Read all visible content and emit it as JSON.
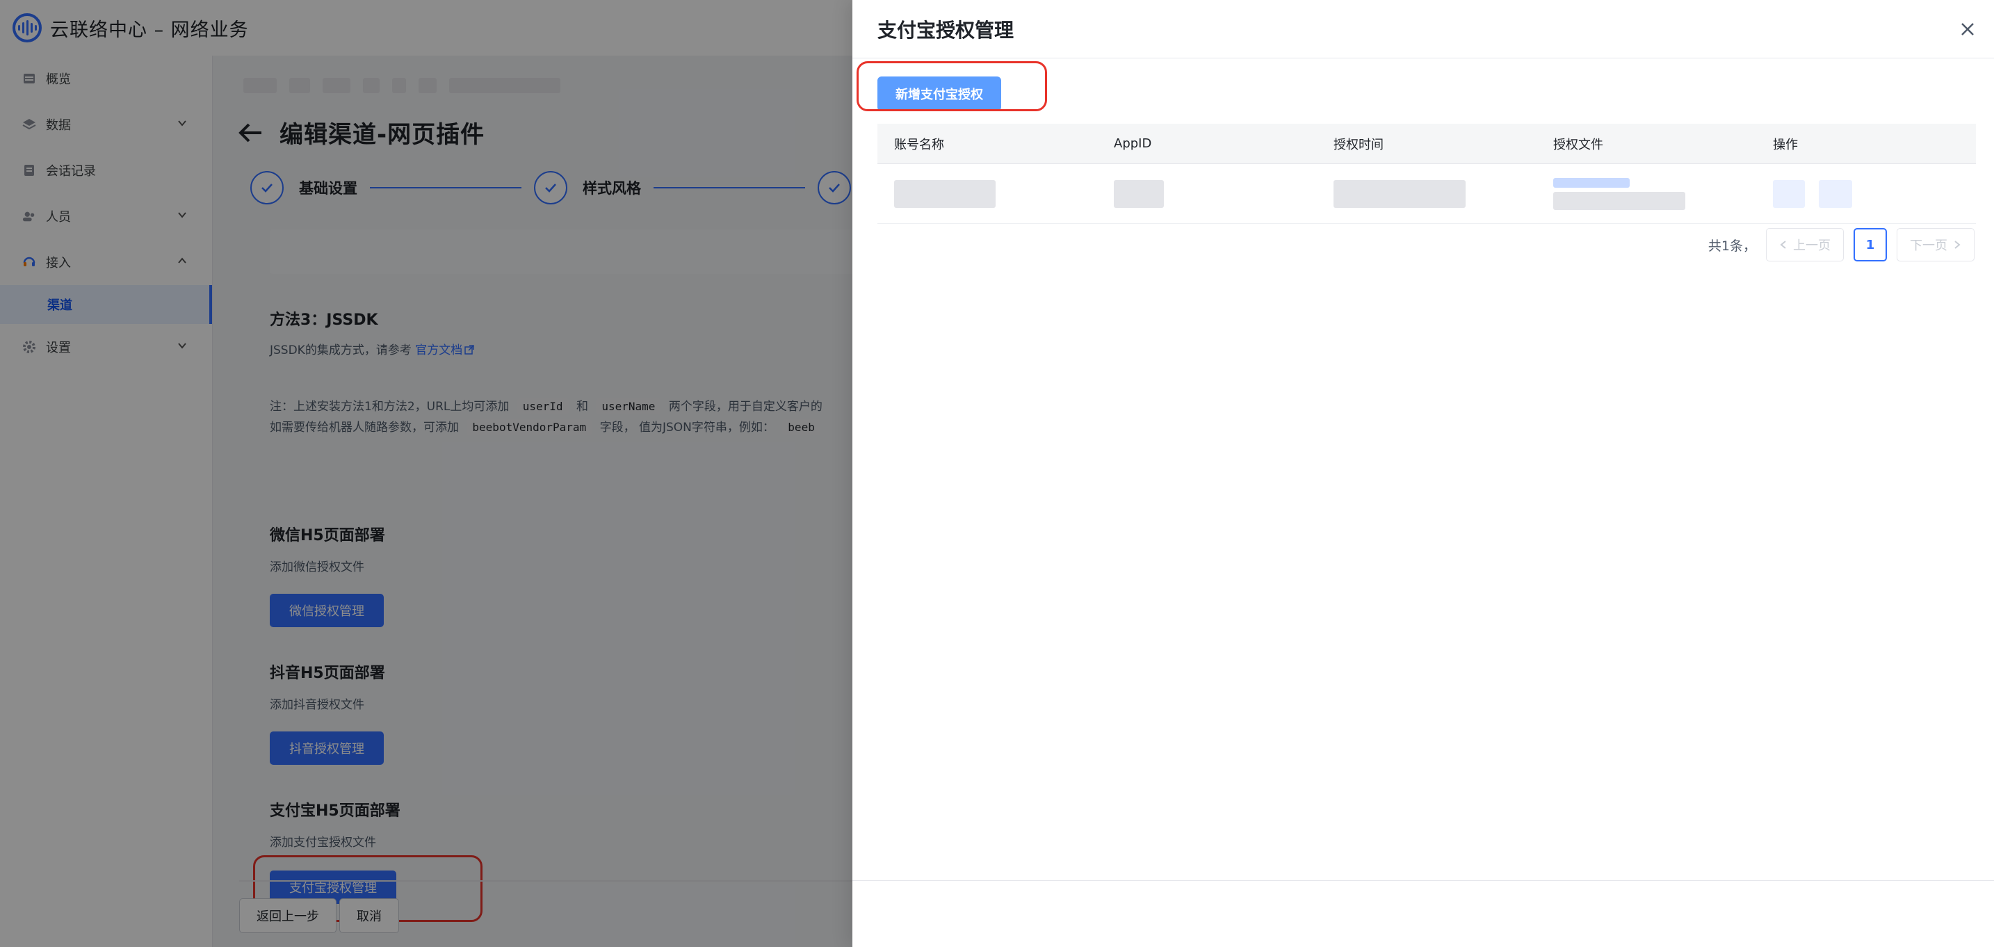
{
  "app": {
    "title": "云联络中心 – 网络业务"
  },
  "sidebar": {
    "items": [
      {
        "label": "概览",
        "icon": "table-icon"
      },
      {
        "label": "数据",
        "icon": "layers-icon",
        "expandable": true
      },
      {
        "label": "会话记录",
        "icon": "file-icon"
      },
      {
        "label": "人员",
        "icon": "users-icon",
        "expandable": true
      },
      {
        "label": "接入",
        "icon": "headset-icon",
        "expandable": true,
        "expanded": true
      },
      {
        "label": "渠道",
        "sub": true,
        "active": true
      },
      {
        "label": "设置",
        "icon": "gear-icon",
        "expandable": true
      }
    ]
  },
  "main": {
    "page_title": "编辑渠道-网页插件",
    "steps": [
      {
        "label": "基础设置"
      },
      {
        "label": "样式风格"
      }
    ],
    "method3_title": "方法3：JSSDK",
    "method3_desc": "JSSDK的集成方式，请参考",
    "method3_link": "官方文档",
    "note_line1_a": "注：上述安装方法1和方法2，URL上均可添加",
    "note_code1": "userId",
    "note_line1_b": "和",
    "note_code2": "userName",
    "note_line1_c": "两个字段，用于自定义客户的",
    "note_line2_a": "如需要传给机器人随路参数，可添加",
    "note_code3": "beebotVendorParam",
    "note_line2_b": "字段， 值为JSON字符串，例如：",
    "note_code4": "beeb",
    "wechat_title": "微信H5页面部署",
    "wechat_desc": "添加微信授权文件",
    "wechat_button": "微信授权管理",
    "douyin_title": "抖音H5页面部署",
    "douyin_desc": "添加抖音授权文件",
    "douyin_button": "抖音授权管理",
    "alipay_title": "支付宝H5页面部署",
    "alipay_desc": "添加支付宝授权文件",
    "alipay_button": "支付宝授权管理",
    "prev_button": "返回上一步",
    "cancel_button": "取消"
  },
  "drawer": {
    "title": "支付宝授权管理",
    "add_button": "新增支付宝授权",
    "columns": [
      "账号名称",
      "AppID",
      "授权时间",
      "授权文件",
      "操作"
    ],
    "pager": {
      "total": "共1条，",
      "prev": "上一页",
      "page": "1",
      "next": "下一页"
    }
  },
  "colors": {
    "accent": "#3370ff",
    "annotation": "#e8332a",
    "add_button": "#5b9dff"
  }
}
